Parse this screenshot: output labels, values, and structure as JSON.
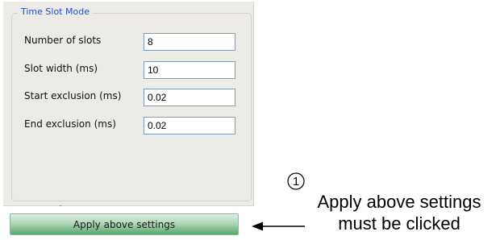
{
  "group": {
    "title": "Time Slot Mode"
  },
  "fields": [
    {
      "label": "Number of slots",
      "value": "8"
    },
    {
      "label": "Slot width (ms)",
      "value": "10"
    },
    {
      "label": "Start exclusion (ms)",
      "value": "0.02"
    },
    {
      "label": "End exclusion (ms)",
      "value": "0.02"
    }
  ],
  "apply_button": {
    "label": "Apply above settings"
  },
  "annotation": {
    "number": "1",
    "line1": "Apply above settings",
    "line2": "must be clicked"
  },
  "colors": {
    "legend_text": "#1f4fbf",
    "panel_bg": "#ecebe7",
    "button_green": "#58a86b",
    "input_border": "#7f9db9"
  }
}
